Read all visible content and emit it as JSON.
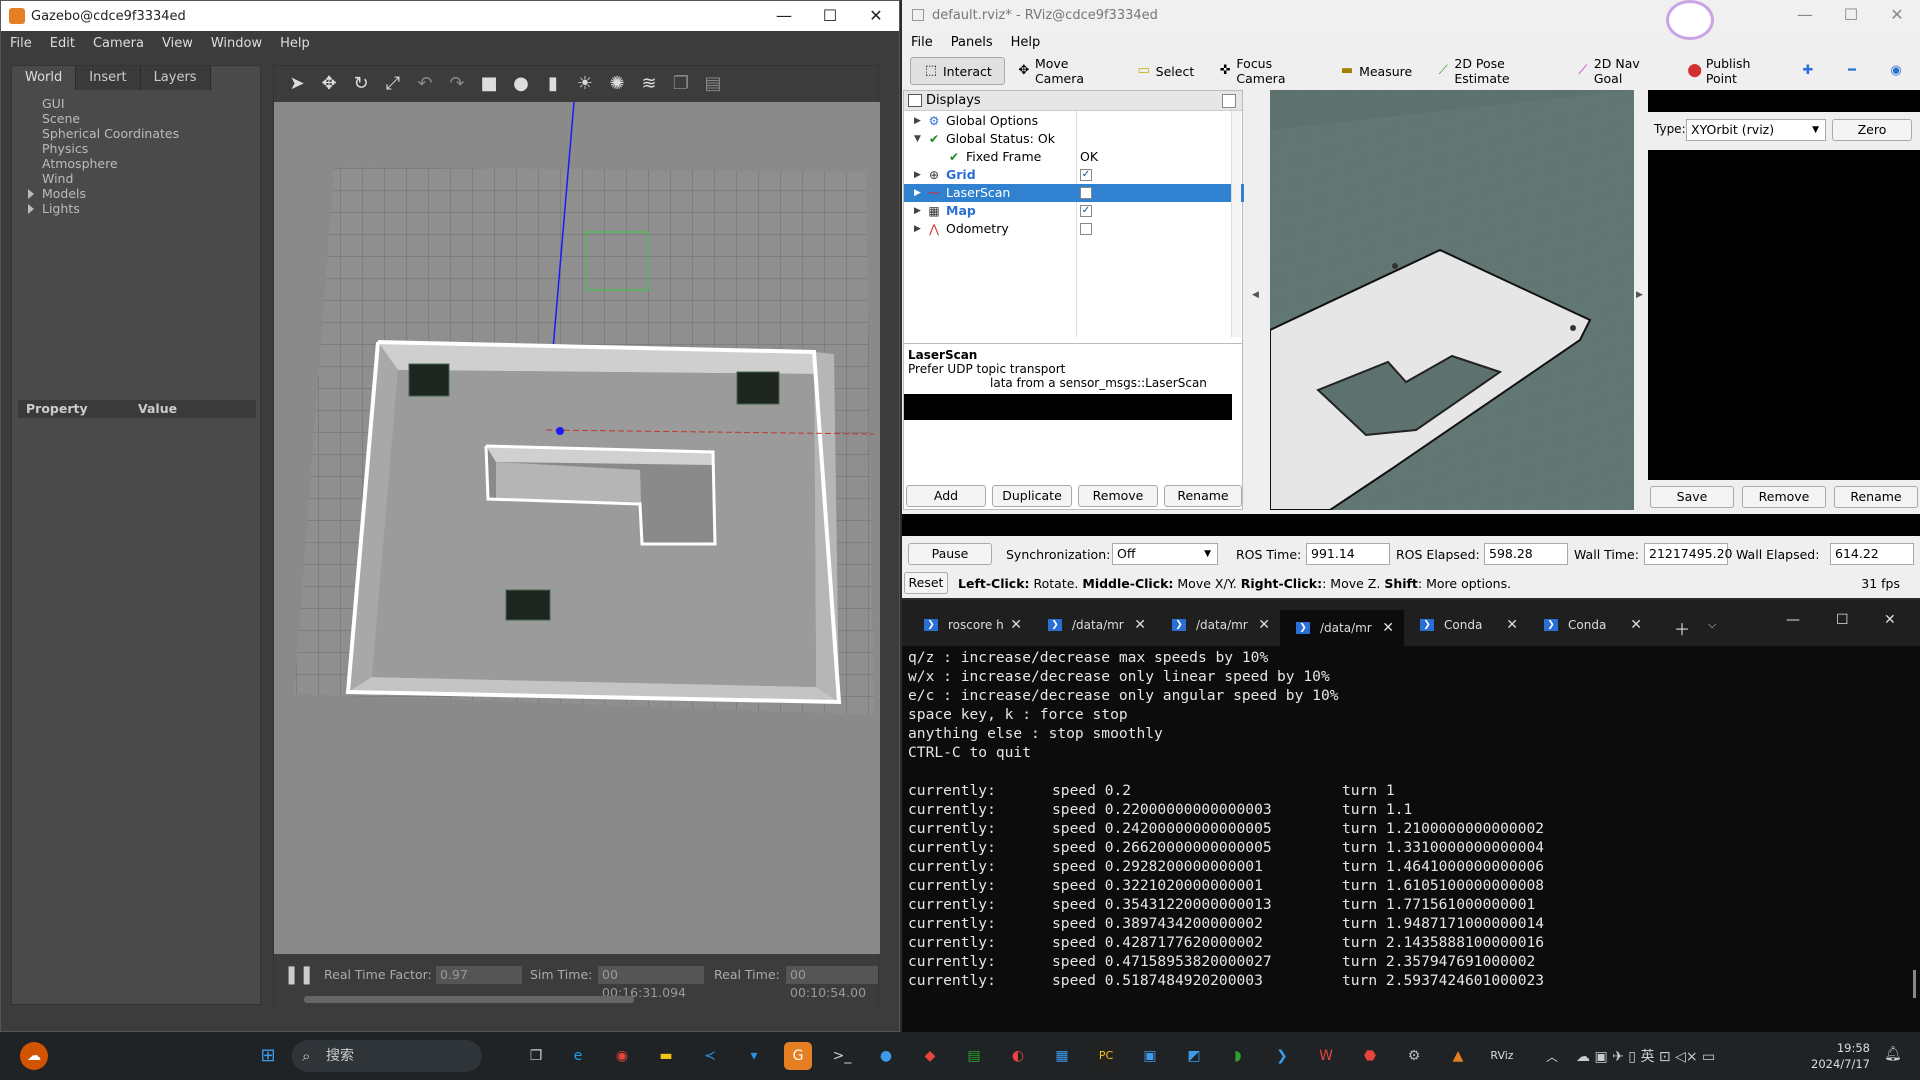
{
  "gazebo": {
    "title": "Gazebo@cdce9f3334ed",
    "menu": [
      "File",
      "Edit",
      "Camera",
      "View",
      "Window",
      "Help"
    ],
    "tabs": [
      "World",
      "Insert",
      "Layers"
    ],
    "tree": [
      "GUI",
      "Scene",
      "Spherical Coordinates",
      "Physics",
      "Atmosphere",
      "Wind",
      "Models",
      "Lights"
    ],
    "prop_header": {
      "property": "Property",
      "value": "Value"
    },
    "bottom": {
      "rtf_label": "Real Time Factor:",
      "rtf": "0.97",
      "sim_label": "Sim Time:",
      "sim": "00 00:16:31.094",
      "real_label": "Real Time:",
      "real": "00 00:10:54.00"
    }
  },
  "rviz": {
    "title": "default.rviz* - RViz@cdce9f3334ed",
    "menu": [
      "File",
      "Panels",
      "Help"
    ],
    "tools": [
      "Interact",
      "Move Camera",
      "Select",
      "Focus Camera",
      "Measure",
      "2D Pose Estimate",
      "2D Nav Goal",
      "Publish Point"
    ],
    "displays_title": "Displays",
    "tree": [
      {
        "label": "Global Options"
      },
      {
        "label": "Global Status: Ok"
      },
      {
        "label": "Fixed Frame",
        "value": "OK"
      },
      {
        "label": "Grid",
        "checked": "✓"
      },
      {
        "label": "LaserScan"
      },
      {
        "label": "Map",
        "checked": "✓"
      },
      {
        "label": "Odometry"
      }
    ],
    "desc_title": "LaserScan",
    "desc_line1": "Prefer UDP topic transport",
    "desc_line2": "lata from a sensor_msgs::LaserScan",
    "disp_buttons": [
      "Add",
      "Duplicate",
      "Remove",
      "Rename"
    ],
    "view_type_label": "Type:",
    "view_type": "XYOrbit (rviz)",
    "zero": "Zero",
    "view_buttons": [
      "Save",
      "Remove",
      "Rename"
    ],
    "pause": "Pause",
    "sync_label": "Synchronization:",
    "sync": "Off",
    "ros_time_label": "ROS Time:",
    "ros_time": "991.14",
    "ros_elapsed_label": "ROS Elapsed:",
    "ros_elapsed": "598.28",
    "wall_time_label": "Wall Time:",
    "wall_time": "21217495.20",
    "wall_elapsed_label": "Wall Elapsed:",
    "wall_elapsed": "614.22",
    "reset": "Reset",
    "hint_bold1": "Left-Click:",
    "hint1": " Rotate. ",
    "hint_bold2": "Middle-Click:",
    "hint2": " Move X/Y. ",
    "hint_bold3": "Right-Click:",
    "hint3": ": Move Z. ",
    "hint_bold4": "Shift",
    "hint4": ": More options.",
    "fps": "31 fps"
  },
  "terminal": {
    "tabs": [
      "roscore h",
      "/data/mr",
      "/data/mr",
      "/data/mr",
      "Conda",
      "Conda"
    ],
    "lines": [
      "q/z : increase/decrease max speeds by 10%",
      "w/x : increase/decrease only linear speed by 10%",
      "e/c : increase/decrease only angular speed by 10%",
      "space key, k : force stop",
      "anything else : stop smoothly",
      "CTRL-C to quit",
      "",
      "currently:\tspeed 0.2\tturn 1",
      "currently:\tspeed 0.22000000000000003\tturn 1.1",
      "currently:\tspeed 0.24200000000000005\tturn 1.2100000000000002",
      "currently:\tspeed 0.26620000000000005\tturn 1.3310000000000004",
      "currently:\tspeed 0.2928200000000001\tturn 1.4641000000000006",
      "currently:\tspeed 0.3221020000000001\tturn 1.6105100000000008",
      "currently:\tspeed 0.35431220000000013\tturn 1.771561000000001",
      "currently:\tspeed 0.3897434200000002\tturn 1.9487171000000014",
      "currently:\tspeed 0.4287177620000002\tturn 2.1435888100000016",
      "currently:\tspeed 0.47158953820000027\tturn 2.357947691000002",
      "currently:\tspeed 0.5187484920200003\tturn 2.5937424601000023"
    ]
  },
  "taskbar": {
    "search": "搜索",
    "time": "19:58",
    "date": "2024/7/17"
  }
}
